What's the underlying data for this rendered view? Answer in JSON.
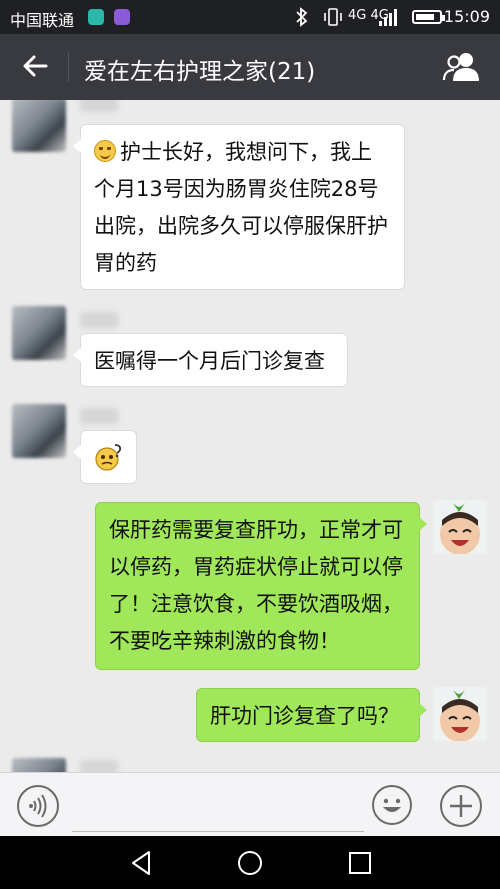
{
  "status_bar": {
    "carrier": "中国联通",
    "time": "15:09",
    "network": "4G 4G",
    "icons": [
      "bluetooth-icon",
      "vibrate-icon",
      "signal-icon",
      "battery-icon"
    ],
    "battery_level": 0.8
  },
  "header": {
    "title": "爱在左右护理之家(21)",
    "back_icon": "arrow-left-icon",
    "members_icon": "group-icon"
  },
  "messages": [
    {
      "side": "in",
      "text": "护士长好，我想问下，我上个月13号因为肠胃炎住院28号出院，出院多久可以停服保肝护胃的药",
      "emoji": "smile-emoji"
    },
    {
      "side": "in",
      "text": "医嘱得一个月后门诊复查"
    },
    {
      "side": "in",
      "sticker": "confused-face-sticker"
    },
    {
      "side": "out",
      "text": "保肝药需要复查肝功，正常才可以停药，胃药症状停止就可以停了！注意饮食，不要饮酒吸烟，不要吃辛辣刺激的食物！"
    },
    {
      "side": "out",
      "text": "肝功门诊复查了吗？"
    }
  ],
  "input_bar": {
    "placeholder": "",
    "icons": [
      "voice-icon",
      "emoji-face-icon",
      "plus-icon"
    ]
  },
  "colors": {
    "status_bg": "#1f2024",
    "header_bg": "#393a3f",
    "chat_bg": "#ebebeb",
    "bubble_in": "#ffffff",
    "bubble_out": "#a0e75a"
  }
}
